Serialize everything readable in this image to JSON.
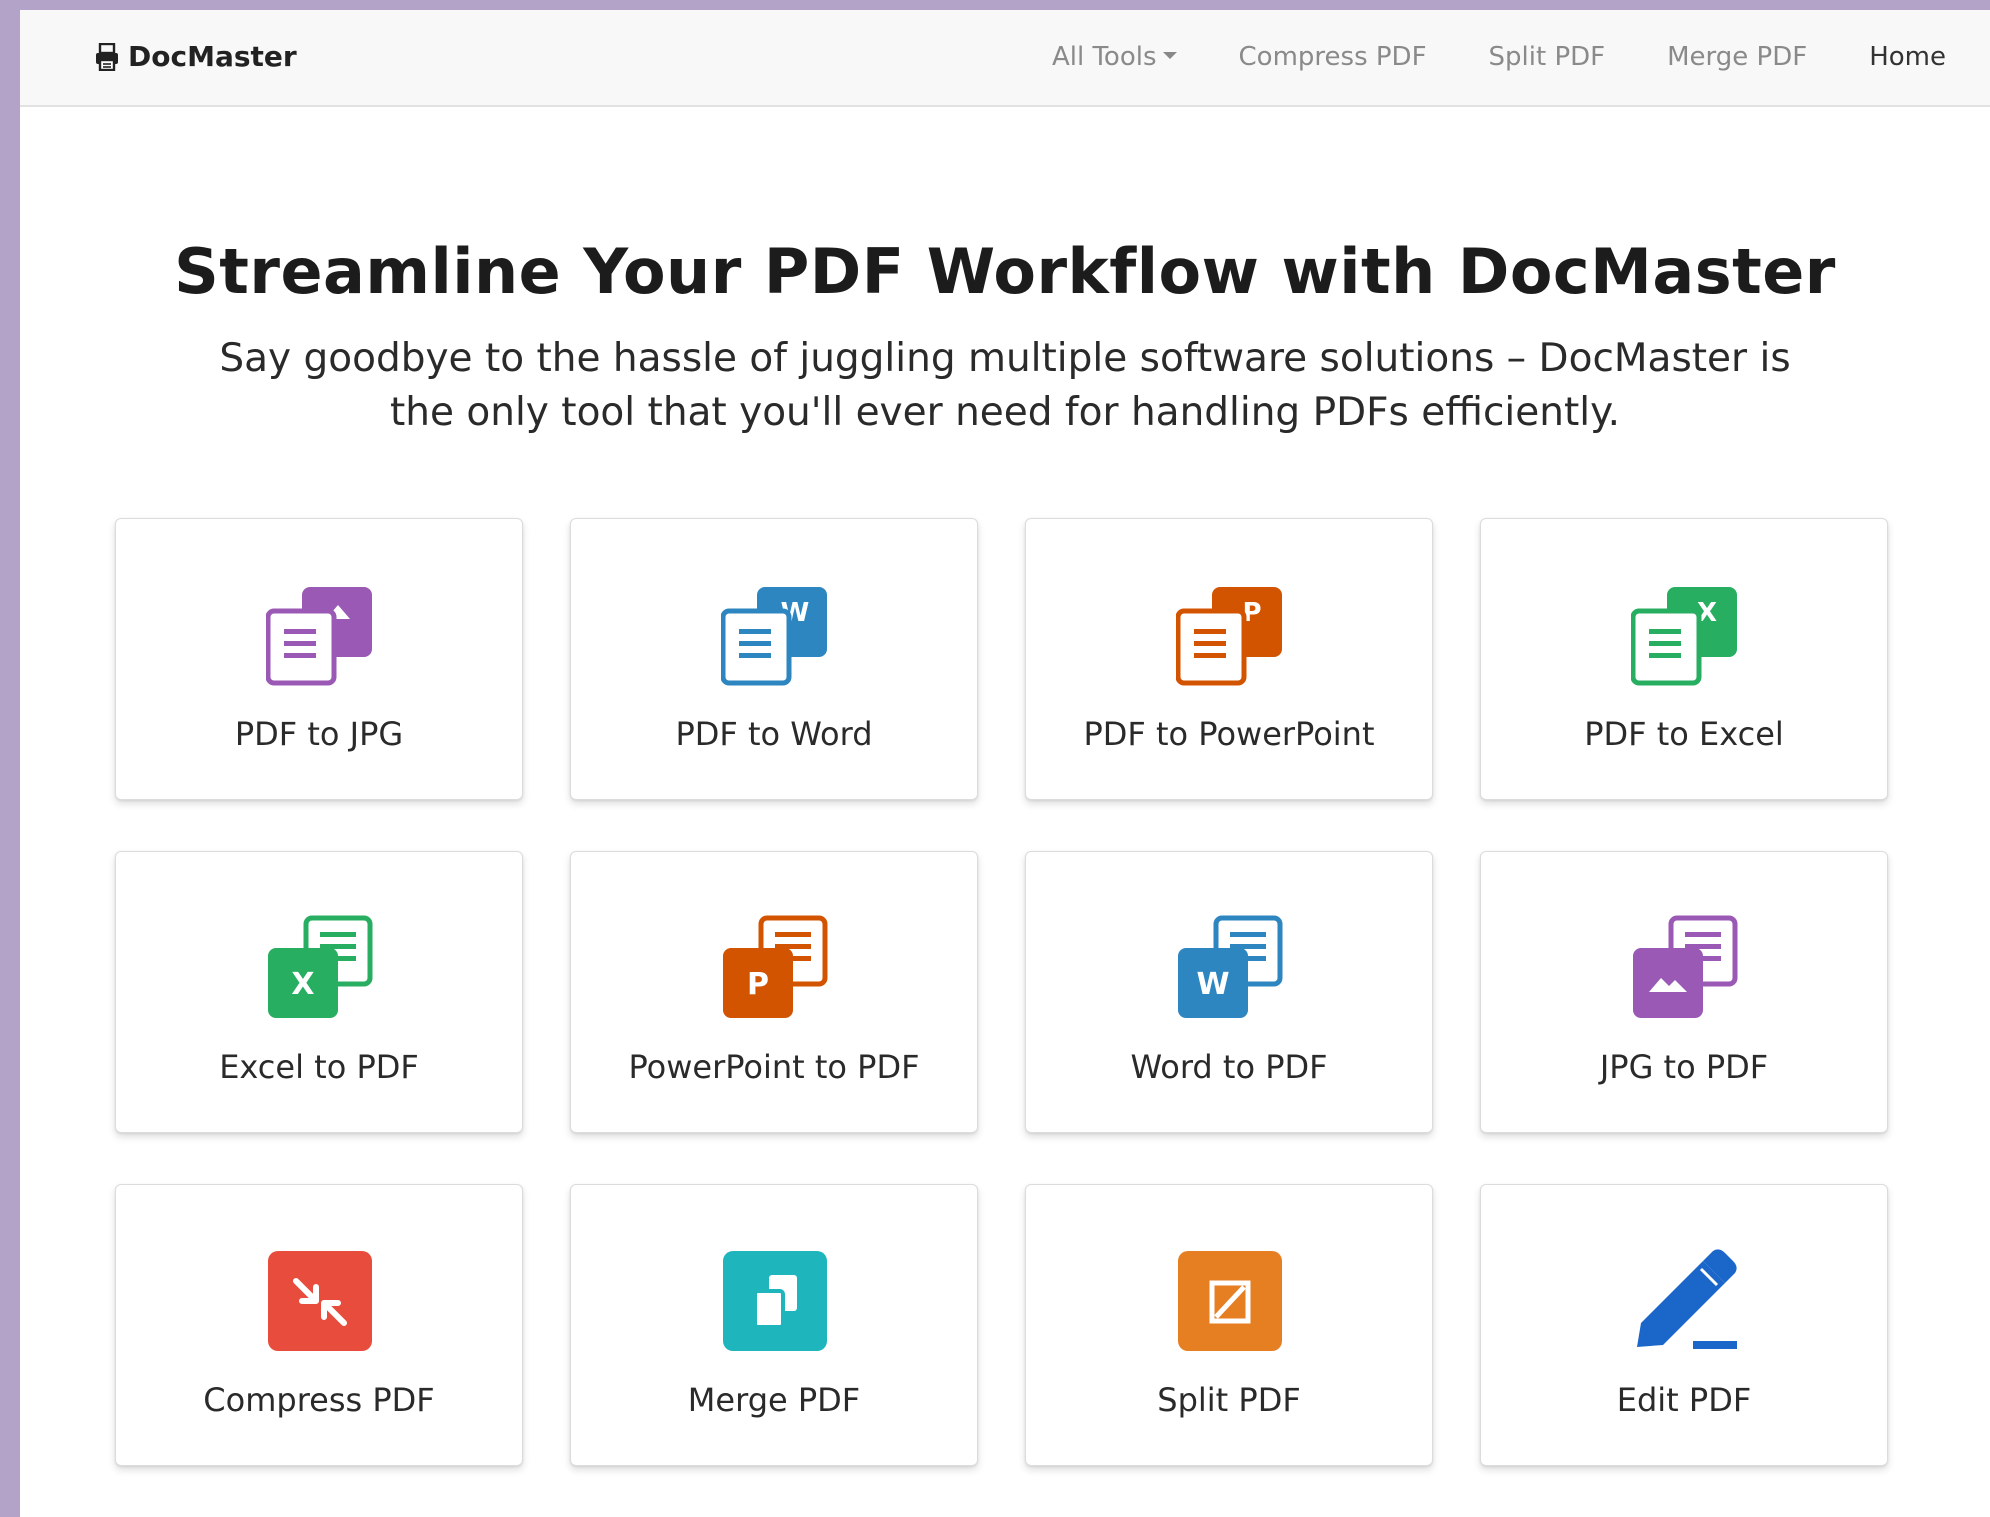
{
  "brand": {
    "name": "DocMaster",
    "icon": "printer-icon"
  },
  "nav": [
    {
      "label": "All Tools",
      "dropdown": true
    },
    {
      "label": "Compress PDF"
    },
    {
      "label": "Split PDF"
    },
    {
      "label": "Merge PDF"
    },
    {
      "label": "Home",
      "active": true
    }
  ],
  "hero": {
    "title": "Streamline Your PDF Workflow with DocMaster",
    "subtitle": "Say goodbye to the hassle of juggling multiple software solutions – DocMaster is the only tool that you'll ever need for handling PDFs efficiently."
  },
  "tools": [
    {
      "label": "PDF to JPG",
      "icon": "pdf-to-jpg-icon",
      "color": "#9b59b6"
    },
    {
      "label": "PDF to Word",
      "icon": "pdf-to-word-icon",
      "color": "#2e86c1"
    },
    {
      "label": "PDF to PowerPoint",
      "icon": "pdf-to-powerpoint-icon",
      "color": "#d35400"
    },
    {
      "label": "PDF to Excel",
      "icon": "pdf-to-excel-icon",
      "color": "#27ae60"
    },
    {
      "label": "Excel to PDF",
      "icon": "excel-to-pdf-icon",
      "color": "#27ae60"
    },
    {
      "label": "PowerPoint to PDF",
      "icon": "powerpoint-to-pdf-icon",
      "color": "#d35400"
    },
    {
      "label": "Word to PDF",
      "icon": "word-to-pdf-icon",
      "color": "#2e86c1"
    },
    {
      "label": "JPG to PDF",
      "icon": "jpg-to-pdf-icon",
      "color": "#9b59b6"
    },
    {
      "label": "Compress PDF",
      "icon": "compress-icon",
      "color": "#e74c3c"
    },
    {
      "label": "Merge PDF",
      "icon": "merge-icon",
      "color": "#1fb5bd"
    },
    {
      "label": "Split PDF",
      "icon": "split-icon",
      "color": "#e67e22"
    },
    {
      "label": "Edit PDF",
      "icon": "pencil-icon",
      "color": "#1b66c9"
    }
  ]
}
